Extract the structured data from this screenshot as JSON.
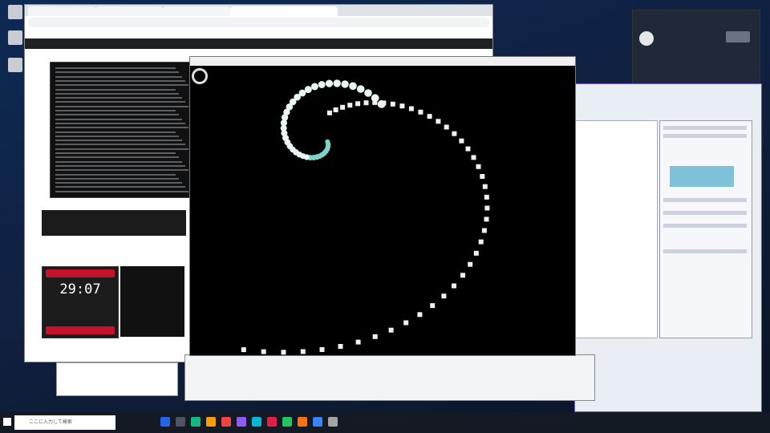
{
  "desktop": {
    "icons": [
      {
        "icon": "recycle-bin-icon",
        "label": ""
      },
      {
        "icon": "file-icon",
        "label": ""
      },
      {
        "icon": "app-icon",
        "label": ""
      }
    ]
  },
  "browser": {
    "tabs": [
      "",
      "",
      "",
      ""
    ],
    "address": "",
    "bookmarks": ""
  },
  "timer": {
    "value": "29:07"
  },
  "taskbar": {
    "search_placeholder": "ここに入力して検索",
    "colors": [
      "#2563eb",
      "#4b5563",
      "#10b981",
      "#f59e0b",
      "#ef4444",
      "#8b5cf6",
      "#06b6d4",
      "#e11d48",
      "#22c55e",
      "#f97316",
      "#3b82f6",
      "#a3a3a3"
    ]
  },
  "spiral": {
    "inner_dots": 40,
    "outer_dots": 44,
    "colors": [
      "#e8f5f3",
      "#7fd3c8"
    ]
  }
}
